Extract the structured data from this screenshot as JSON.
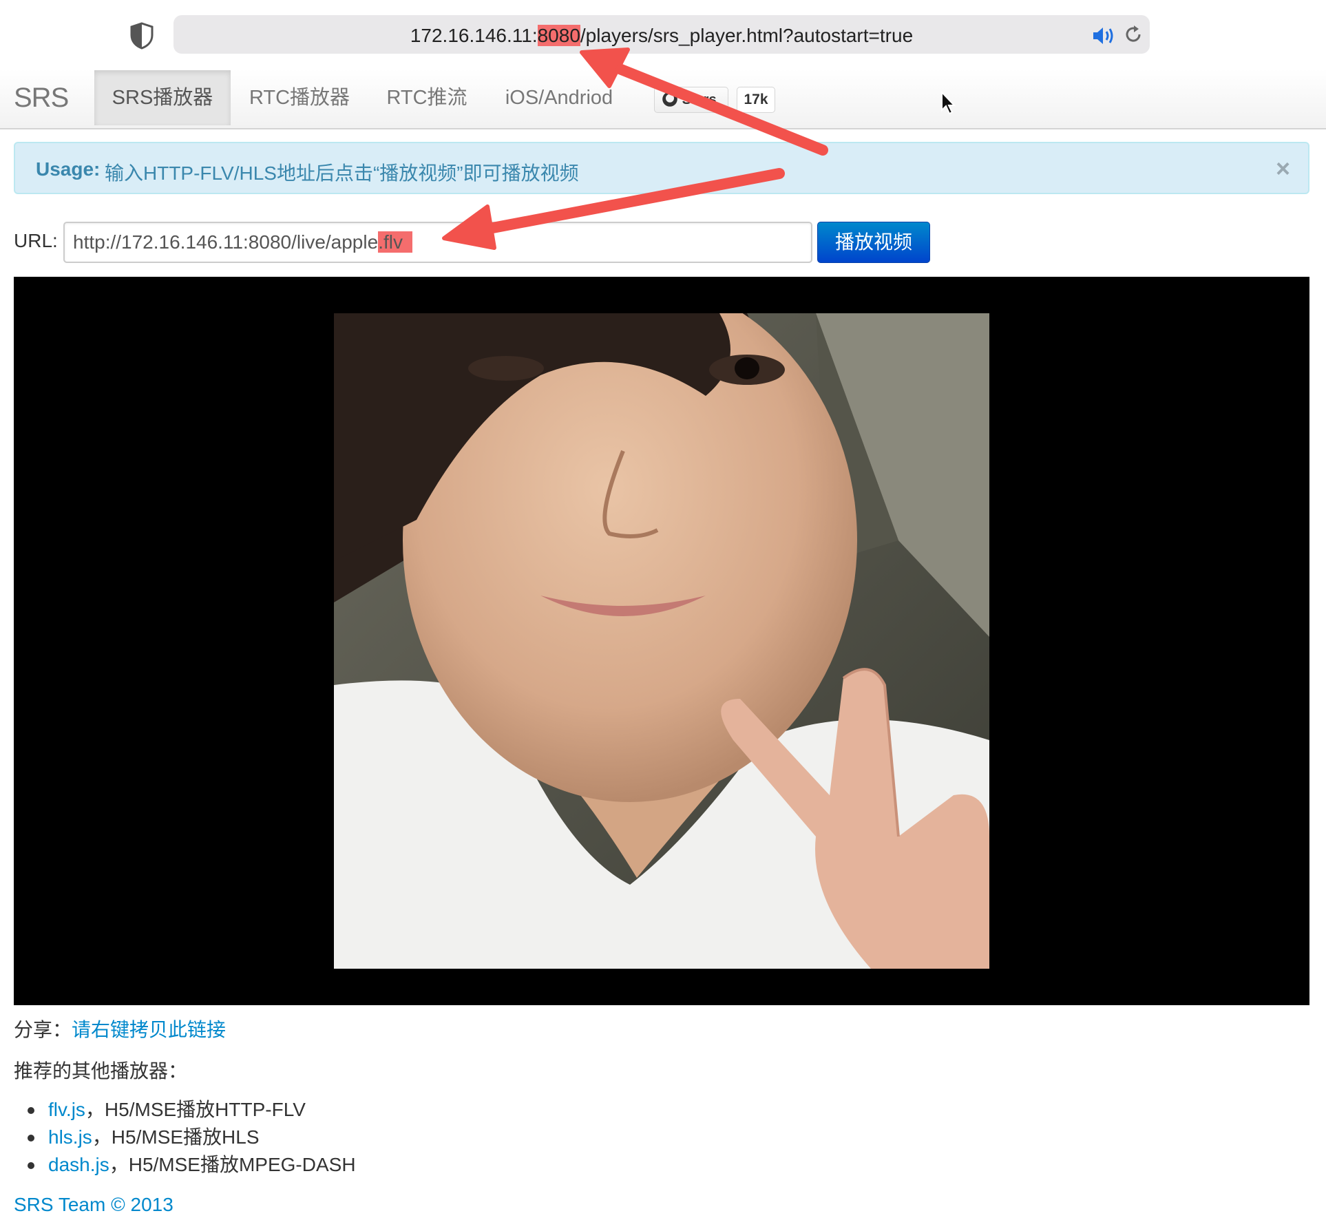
{
  "browser": {
    "url_host": "172.16.146.11:",
    "url_port": "8080",
    "url_path": "/players/srs_player.html?autostart=true",
    "icons": [
      "shield-icon",
      "speaker-icon",
      "reload-icon"
    ]
  },
  "navbar": {
    "brand": "SRS",
    "items": [
      {
        "label": "SRS播放器",
        "active": true
      },
      {
        "label": "RTC播放器",
        "active": false
      },
      {
        "label": "RTC推流",
        "active": false
      },
      {
        "label": "iOS/Andriod",
        "active": false
      }
    ],
    "github_label": "Stars",
    "github_count": "17k"
  },
  "alert": {
    "strong": "Usage:",
    "message": "输入HTTP-FLV/HLS地址后点击“播放视频”即可播放视频",
    "close": "×"
  },
  "url_form": {
    "label": "URL:",
    "value_prefix": "http://172.16.146.11:8080/live/apple",
    "value_highlight": ".flv",
    "button": "播放视频"
  },
  "share": {
    "label": "分享：",
    "link": "请右键拷贝此链接"
  },
  "recommend": {
    "title": "推荐的其他播放器：",
    "items": [
      {
        "name": "flv.js",
        "desc": "，H5/MSE播放HTTP-FLV"
      },
      {
        "name": "hls.js",
        "desc": "，H5/MSE播放HLS"
      },
      {
        "name": "dash.js",
        "desc": "，H5/MSE播放MPEG-DASH"
      }
    ]
  },
  "footer": "SRS Team © 2013",
  "colors": {
    "accent": "#0088cc",
    "highlight": "#f46d6d",
    "arrow": "#f2524c",
    "alert_bg": "#d9edf7",
    "alert_text": "#3a87ad"
  }
}
